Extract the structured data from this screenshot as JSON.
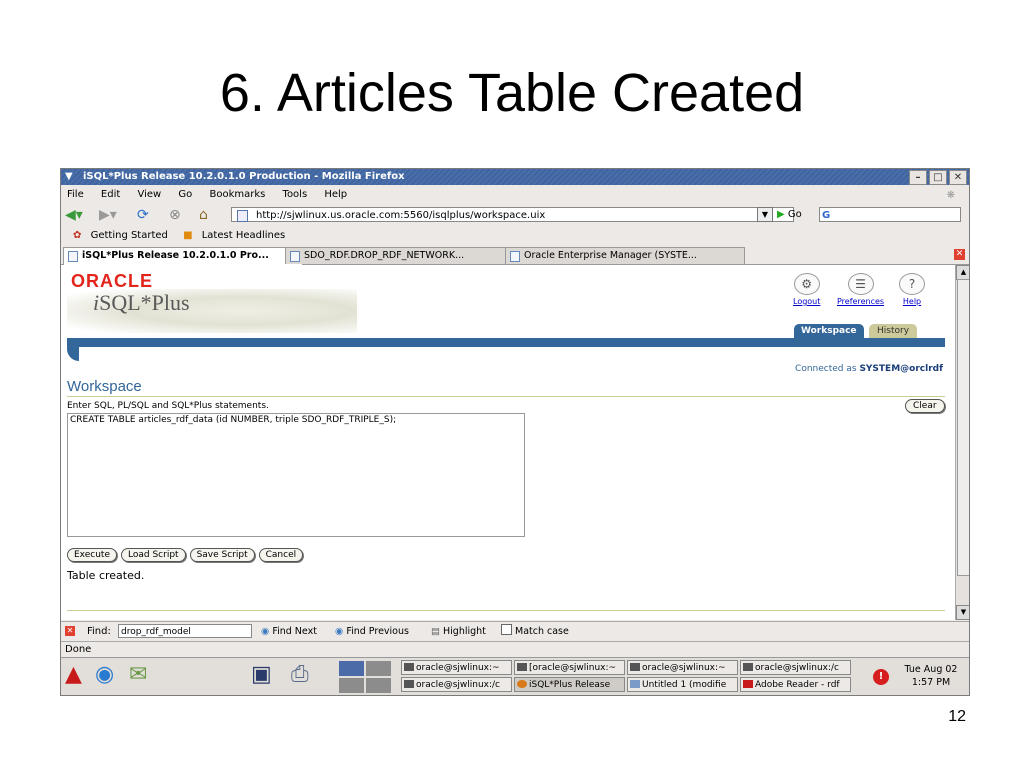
{
  "slide": {
    "title": "6. Articles Table Created",
    "page_number": "12"
  },
  "window": {
    "title": "iSQL*Plus Release 10.2.0.1.0 Production - Mozilla Firefox"
  },
  "menubar": [
    "File",
    "Edit",
    "View",
    "Go",
    "Bookmarks",
    "Tools",
    "Help"
  ],
  "navbar": {
    "url": "http://sjwlinux.us.oracle.com:5560/isqlplus/workspace.uix",
    "go_label": "Go",
    "search_value": "G"
  },
  "bookmarks": [
    "Getting Started",
    "Latest Headlines"
  ],
  "tabs": [
    "iSQL*Plus Release 10.2.0.1.0 Pro...",
    "SDO_RDF.DROP_RDF_NETWORK...",
    "Oracle Enterprise Manager (SYSTE..."
  ],
  "page": {
    "brand_logo": "ORACLE",
    "brand_product": "SQL*Plus",
    "brand_i": "i",
    "global_buttons": [
      "Logout",
      "Preferences",
      "Help"
    ],
    "page_tabs": [
      "Workspace",
      "History"
    ],
    "connected_label": "Connected as",
    "connected_user": "SYSTEM@orclrdf",
    "heading": "Workspace",
    "instructions": "Enter SQL, PL/SQL and SQL*Plus statements.",
    "clear_label": "Clear",
    "sql_text": "CREATE TABLE articles_rdf_data (id NUMBER, triple SDO_RDF_TRIPLE_S);",
    "buttons": [
      "Execute",
      "Load Script",
      "Save Script",
      "Cancel"
    ],
    "result": "Table created."
  },
  "findbar": {
    "label": "Find:",
    "value": "drop_rdf_model",
    "find_next": "Find Next",
    "find_previous": "Find Previous",
    "highlight": "Highlight",
    "match_case": "Match case"
  },
  "status": "Done",
  "taskbar": {
    "windows": [
      "oracle@sjwlinux:~",
      "[oracle@sjwlinux:~",
      "oracle@sjwlinux:~",
      "oracle@sjwlinux:/c",
      "oracle@sjwlinux:/c",
      "iSQL*Plus Release",
      "Untitled 1 (modifie",
      "Adobe Reader - rdf"
    ],
    "clock_day": "Tue Aug 02",
    "clock_time": "1:57 PM"
  }
}
